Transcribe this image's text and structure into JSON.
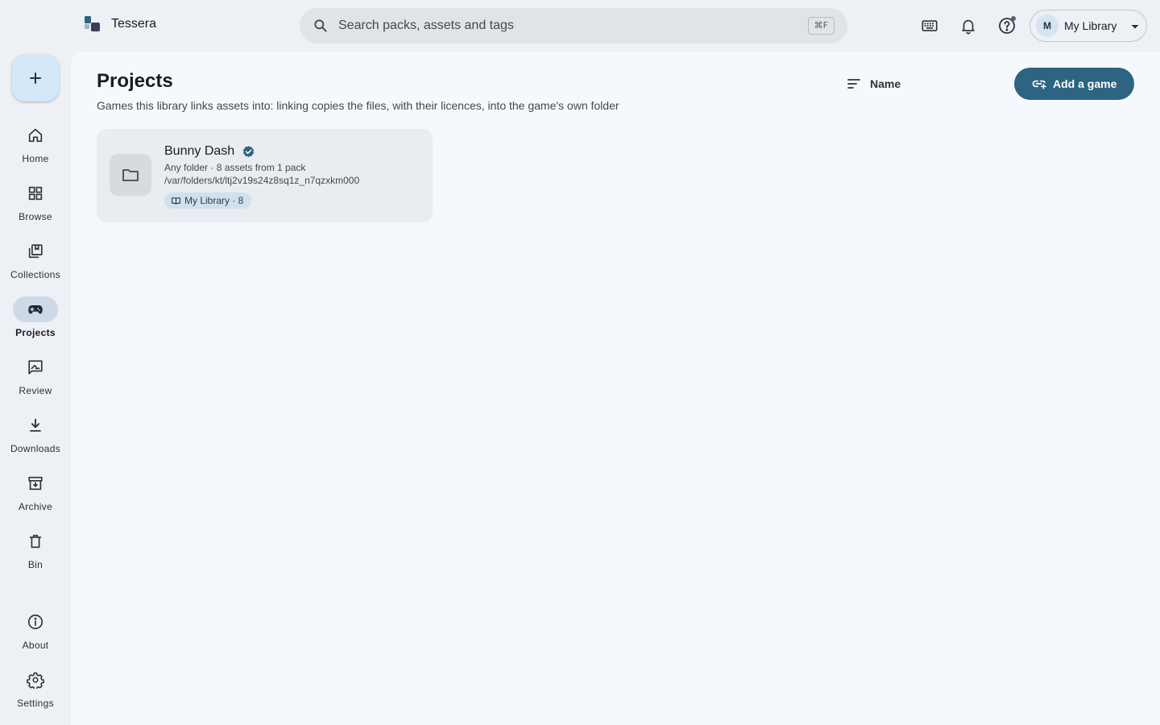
{
  "app": {
    "title": "Tessera"
  },
  "search": {
    "placeholder": "Search packs, assets and tags",
    "shortcut": "⌘F"
  },
  "header_icons": [
    {
      "name": "keyboard-shortcuts-icon"
    },
    {
      "name": "notifications-icon"
    },
    {
      "name": "help-icon"
    }
  ],
  "library_switcher": {
    "avatar": "M",
    "name": "My Library"
  },
  "sidebar": {
    "fab_icon": "plus-icon",
    "items": [
      {
        "label": "Home",
        "icon": "home-icon",
        "active": false
      },
      {
        "label": "Browse",
        "icon": "grid-icon",
        "active": false
      },
      {
        "label": "Collections",
        "icon": "collections-icon",
        "active": false
      },
      {
        "label": "Projects",
        "icon": "gamepad-icon",
        "active": true
      },
      {
        "label": "Review",
        "icon": "review-icon",
        "active": false
      },
      {
        "label": "Downloads",
        "icon": "download-icon",
        "active": false
      },
      {
        "label": "Archive",
        "icon": "archive-icon",
        "active": false
      },
      {
        "label": "Bin",
        "icon": "trash-icon",
        "active": false
      }
    ],
    "bottom_items": [
      {
        "label": "About",
        "icon": "info-icon"
      },
      {
        "label": "Settings",
        "icon": "gear-icon"
      }
    ]
  },
  "main": {
    "title": "Projects",
    "subtitle": "Games this library links assets into: linking copies the files, with their licences, into the game's own folder",
    "sort": {
      "label": "Name"
    },
    "add_button": {
      "label": "Add a game"
    },
    "projects": [
      {
        "name": "Bunny Dash",
        "verified": true,
        "meta": "Any folder · 8 assets from 1 pack",
        "path": "/var/folders/kt/ltj2v19s24z8sq1z_n7qzxkm000",
        "chip": "My Library · 8"
      }
    ]
  },
  "colors": {
    "accent": "#2c6482",
    "fab": "#d4e8f9",
    "active_pill": "#cbdae6",
    "chip": "#cfe0ee",
    "verified": "#2c6482"
  }
}
